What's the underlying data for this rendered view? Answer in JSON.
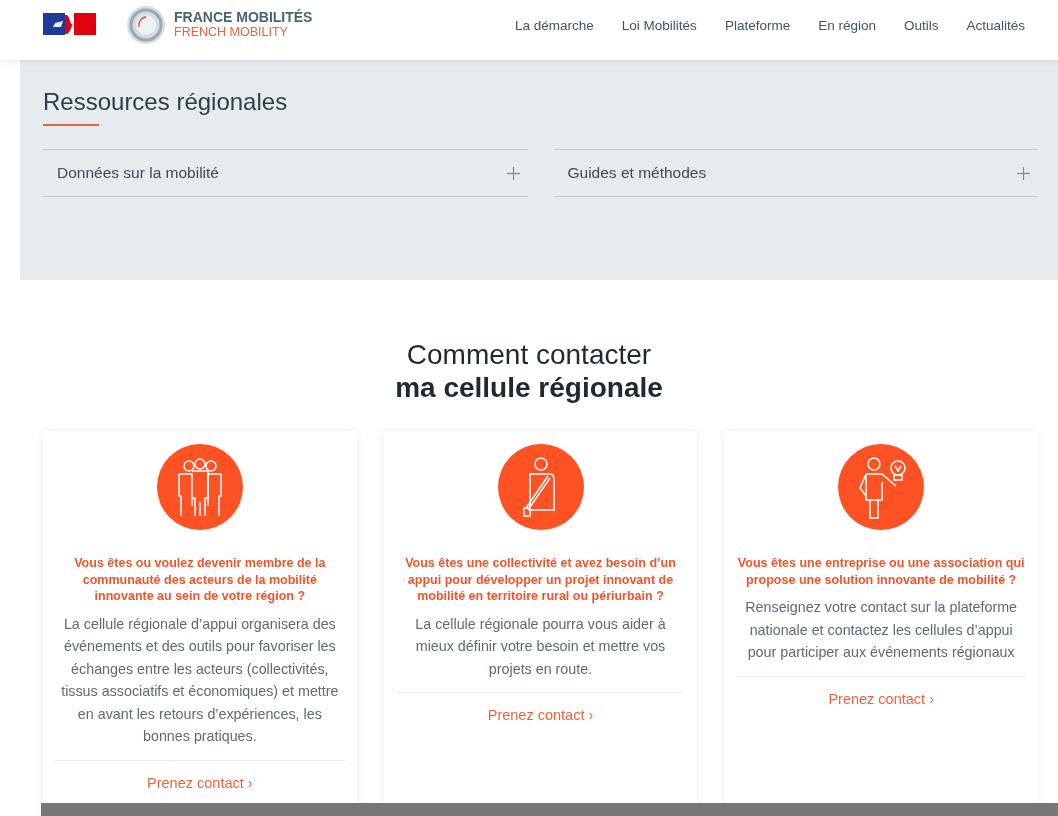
{
  "header": {
    "brand": "FRANCE MOBILITÉS",
    "brand_sub": "FRENCH MOBILITY",
    "nav": [
      "La démarche",
      "Loi Mobilités",
      "Plateforme",
      "En région",
      "Outils",
      "Actualités"
    ]
  },
  "resources": {
    "title": "Ressources régionales",
    "accordions": [
      {
        "label": "Données sur la mobilité",
        "expanded": false
      },
      {
        "label": "Guides et méthodes",
        "expanded": false
      }
    ]
  },
  "contact": {
    "heading": "Comment contacter",
    "heading_bold": "ma cellule régionale",
    "cards": [
      {
        "kind": "group",
        "question": "Vous êtes ou voulez devenir membre de la communauté des acteurs de la mobilité innovante au sein de votre région ?",
        "text": "La cellule régionale d’appui organisera des événements et des outils pour favoriser les échanges entre les acteurs (collectivités, tissus associatifs et économiques) et mettre en avant les retours d’expériences, les bonnes pratiques.",
        "link": "Prenez contact ›"
      },
      {
        "kind": "seated",
        "question": "Vous êtes une collectivité et avez besoin d’un appui pour développer un projet innovant de mobilité en territoire rural ou périurbain ?",
        "text": "La cellule régionale pourra vous aider à mieux définir votre besoin et mettre vos projets en route.",
        "link": "Prenez contact ›"
      },
      {
        "kind": "idea",
        "question": "Vous êtes une entreprise ou une association qui propose une solution innovante de mobilité ?",
        "text": "Renseignez votre contact sur la plateforme nationale et contactez les cellules d’appui pour participer aux événements régionaux",
        "link": "Prenez contact ›"
      }
    ]
  }
}
